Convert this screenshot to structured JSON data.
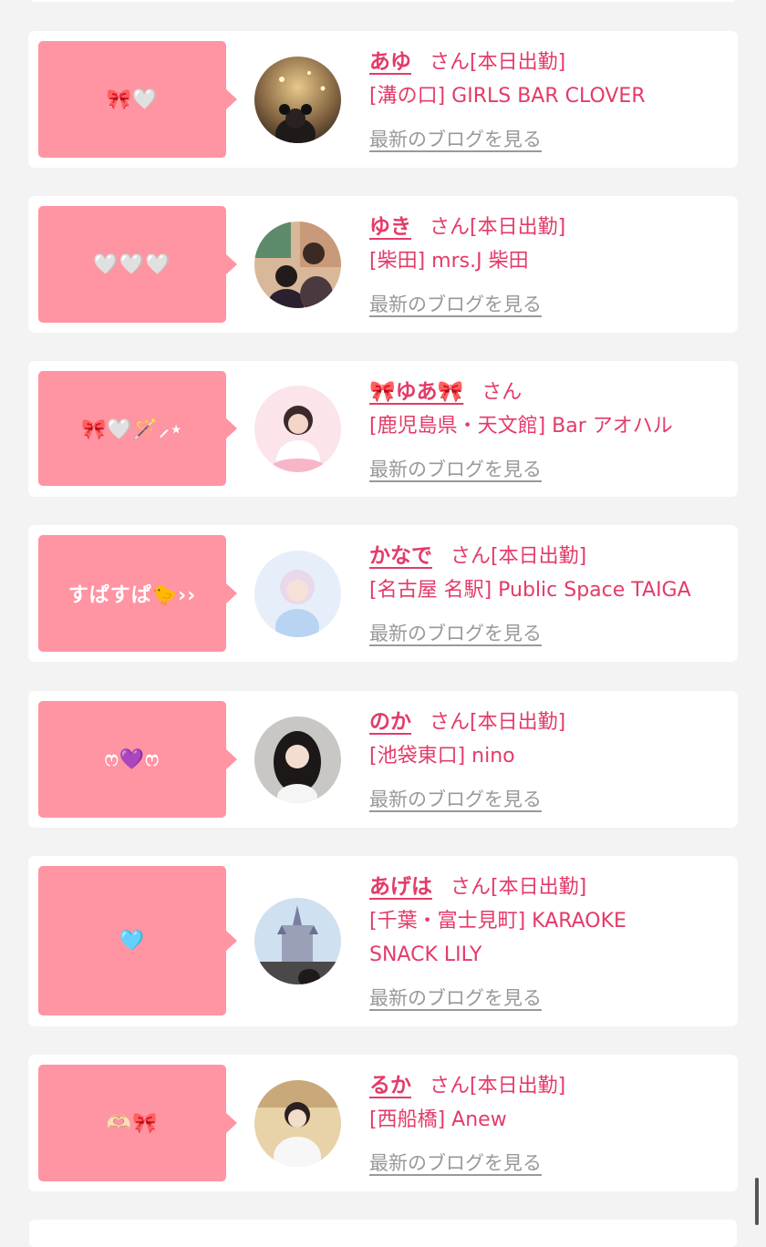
{
  "san_label": "さん",
  "blog_link_label": "最新のブログを見る",
  "colors": {
    "accent": "#e33b68",
    "bubble": "#ff94a3",
    "link_gray": "#999999",
    "background": "#f3f3f3"
  },
  "entries": [
    {
      "comment": "🎀🤍",
      "name": "あゆ",
      "status": "[本日出勤]",
      "shop": "[溝の口] GIRLS BAR CLOVER",
      "avatar_icon": "photo-avatar"
    },
    {
      "comment": "🤍🤍🤍",
      "name": "ゆき",
      "status": "[本日出勤]",
      "shop": "[柴田] mrs.J 柴田",
      "avatar_icon": "photo-avatar"
    },
    {
      "comment": "🎀🤍🪄⸝⋆",
      "name": "🎀ゆあ🎀",
      "status": "",
      "shop": "[鹿児島県・天文館] Bar アオハル",
      "avatar_icon": "photo-avatar"
    },
    {
      "comment": "すぱすぱ🐤››",
      "name": "かなで",
      "status": "[本日出勤]",
      "shop": "[名古屋 名駅] Public Space TAIGA",
      "avatar_icon": "photo-avatar"
    },
    {
      "comment": "ෆ💜ෆ",
      "name": "のか",
      "status": "[本日出勤]",
      "shop": "[池袋東口] nino",
      "avatar_icon": "photo-avatar"
    },
    {
      "comment": "🩵",
      "name": "あげは",
      "status": "[本日出勤]",
      "shop": "[千葉・富士見町] KARAOKE SNACK LILY",
      "avatar_icon": "photo-avatar"
    },
    {
      "comment": "🫶🏻🎀",
      "name": "るか",
      "status": "[本日出勤]",
      "shop": "[西船橋] Anew",
      "avatar_icon": "photo-avatar"
    }
  ]
}
